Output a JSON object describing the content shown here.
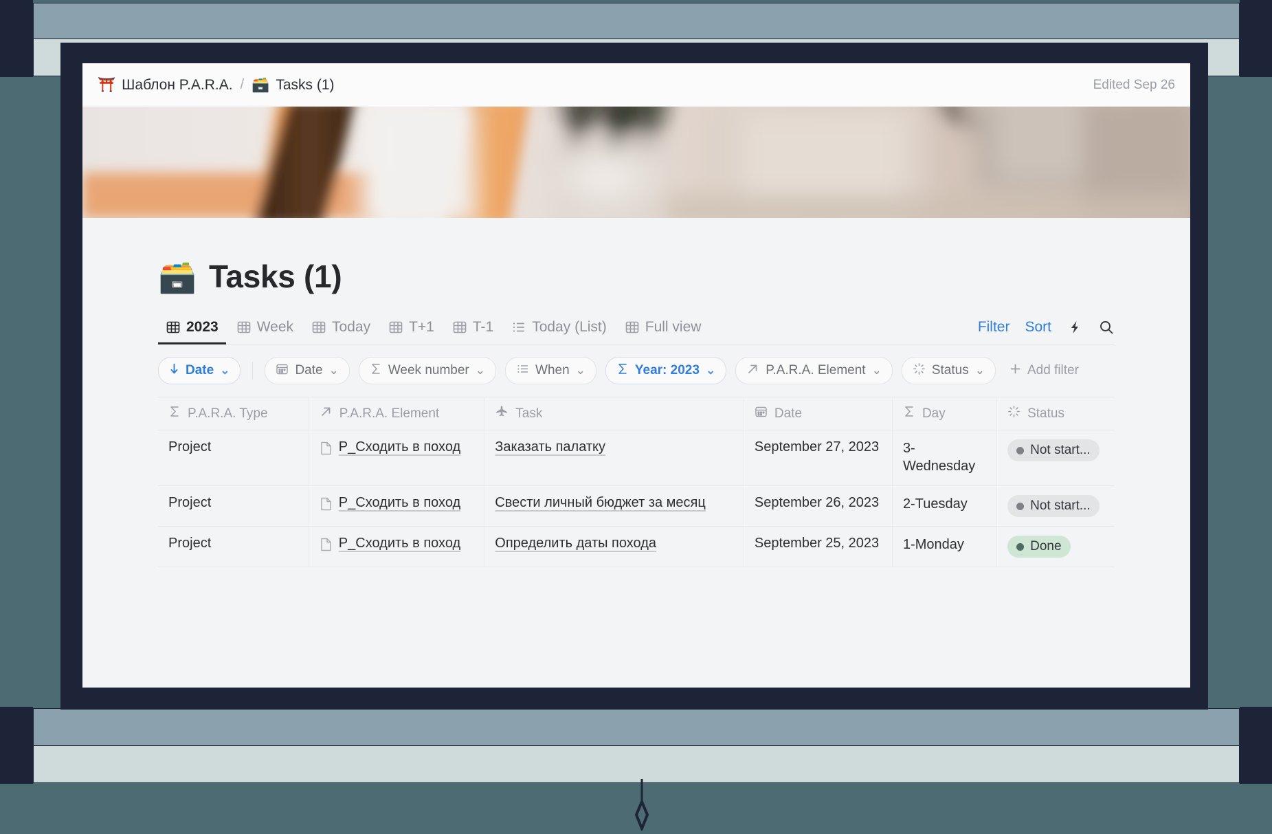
{
  "breadcrumb": {
    "items": [
      {
        "emoji": "⛩️",
        "label": "Шаблон P.A.R.A.",
        "icon": "torii-icon"
      },
      {
        "emoji": "🗃️",
        "label": "Tasks (1)",
        "icon": "card-file-box-icon"
      }
    ],
    "separator": "/",
    "edited": "Edited Sep 26"
  },
  "page": {
    "emoji": "🗃️",
    "title": "Tasks (1)"
  },
  "tabs": [
    {
      "label": "2023",
      "icon": "table-icon",
      "active": true
    },
    {
      "label": "Week",
      "icon": "table-icon",
      "active": false
    },
    {
      "label": "Today",
      "icon": "table-icon",
      "active": false
    },
    {
      "label": "T+1",
      "icon": "table-icon",
      "active": false
    },
    {
      "label": "T-1",
      "icon": "table-icon",
      "active": false
    },
    {
      "label": "Today (List)",
      "icon": "list-icon",
      "active": false
    },
    {
      "label": "Full view",
      "icon": "table-icon",
      "active": false
    }
  ],
  "toolbar": {
    "filter_label": "Filter",
    "sort_label": "Sort",
    "automation_icon": "lightning-bolt-icon",
    "search_icon": "search-icon",
    "link_color": "#2f7ddb"
  },
  "chips": {
    "sort": {
      "label": "Date",
      "icon": "arrow-down-icon",
      "caret": "⌄",
      "active": true
    },
    "filters": [
      {
        "label": "Date",
        "icon": "calendar-icon",
        "caret": "⌄",
        "active": false
      },
      {
        "label": "Week number",
        "icon": "sigma-icon",
        "caret": "⌄",
        "active": false
      },
      {
        "label": "When",
        "icon": "list-icon",
        "caret": "⌄",
        "active": false
      },
      {
        "label": "Year: 2023",
        "icon": "sigma-icon",
        "caret": "⌄",
        "active": true
      },
      {
        "label": "P.A.R.A. Element",
        "icon": "relation-icon",
        "caret": "⌄",
        "active": false
      },
      {
        "label": "Status",
        "icon": "status-icon",
        "caret": "⌄",
        "active": false
      }
    ],
    "add_filter": {
      "label": "Add filter",
      "icon": "plus-icon"
    }
  },
  "table": {
    "columns": [
      {
        "label": "P.A.R.A. Type",
        "icon": "sigma-icon"
      },
      {
        "label": "P.A.R.A. Element",
        "icon": "relation-icon"
      },
      {
        "label": "Task",
        "icon": "airplane-icon"
      },
      {
        "label": "Date",
        "icon": "calendar-icon"
      },
      {
        "label": "Day",
        "icon": "sigma-icon"
      },
      {
        "label": "Status",
        "icon": "status-icon"
      }
    ],
    "rows": [
      {
        "type": "Project",
        "element": "P_Сходить в поход",
        "task": "Заказать палатку",
        "date": "September 27, 2023",
        "day": "3-Wednesday",
        "status": "Not start...",
        "status_style": "gray"
      },
      {
        "type": "Project",
        "element": "P_Сходить в поход",
        "task": "Свести личный бюджет за месяц",
        "date": "September 26, 2023",
        "day": "2-Tuesday",
        "status": "Not start...",
        "status_style": "gray"
      },
      {
        "type": "Project",
        "element": "P_Сходить в поход",
        "task": "Определить даты похода",
        "date": "September 25, 2023",
        "day": "1-Monday",
        "status": "Done",
        "status_style": "green"
      }
    ]
  },
  "colors": {
    "frame": "#1e2437",
    "backdrop": "#4c6b72",
    "chrome_upper": "#8ba2ae",
    "chrome_lower": "#cfdada",
    "status_gray": "#e3e4e6",
    "status_green": "#cfe6d4"
  }
}
